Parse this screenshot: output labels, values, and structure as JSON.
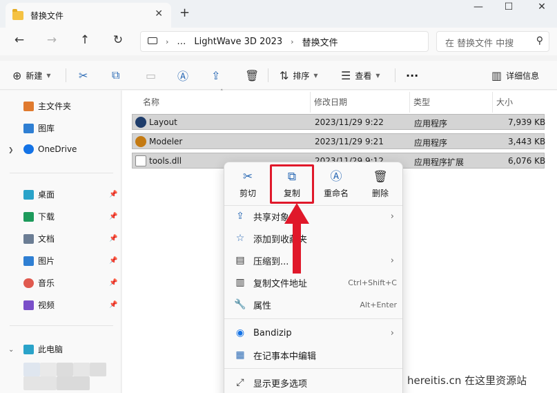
{
  "titlebar": {
    "tab_title": "替换文件",
    "tab_close": "✕",
    "new_tab": "+",
    "minimize": "—",
    "maximize": "☐",
    "close": "✕"
  },
  "addressbar": {
    "back": "←",
    "forward": "→",
    "up": "↑",
    "refresh": "↻",
    "breadcrumbs": [
      "…",
      "LightWave 3D 2023",
      "替换文件"
    ],
    "separator": "›",
    "search_placeholder": "在 替换文件 中搜",
    "search_icon": "search-icon"
  },
  "toolbar": {
    "new_label": "新建",
    "sort_label": "排序",
    "view_label": "查看",
    "more": "···",
    "details_label": "详细信息"
  },
  "sidebar": {
    "items": [
      {
        "label": "主文件夹",
        "icon": "home-icon",
        "color": "#e07a2e"
      },
      {
        "label": "图库",
        "icon": "gallery-icon",
        "color": "#2f7fd3"
      },
      {
        "label": "OneDrive",
        "icon": "cloud-icon",
        "color": "#1473e6"
      },
      {
        "label": "桌面",
        "icon": "desktop-icon",
        "color": "#2aa3c9"
      },
      {
        "label": "下载",
        "icon": "download-icon",
        "color": "#1d9a5b"
      },
      {
        "label": "文档",
        "icon": "document-icon",
        "color": "#6b7d94"
      },
      {
        "label": "图片",
        "icon": "pictures-icon",
        "color": "#2f7fd3"
      },
      {
        "label": "音乐",
        "icon": "music-icon",
        "color": "#e05a4f"
      },
      {
        "label": "视频",
        "icon": "video-icon",
        "color": "#7a4fc9"
      },
      {
        "label": "此电脑",
        "icon": "this-pc-icon",
        "color": "#2aa3c9"
      }
    ],
    "pin_glyph": "📌"
  },
  "filelist": {
    "columns": [
      "名称",
      "修改日期",
      "类型",
      "大小"
    ],
    "rows": [
      {
        "name": "Layout",
        "date": "2023/11/29 9:22",
        "type": "应用程序",
        "size": "7,939 KB",
        "icon": "layout-app-icon",
        "color": "#1f3d6b"
      },
      {
        "name": "Modeler",
        "date": "2023/11/29 9:21",
        "type": "应用程序",
        "size": "3,443 KB",
        "icon": "modeler-app-icon",
        "color": "#c47a12"
      },
      {
        "name": "tools.dll",
        "date": "2023/11/29 9:12",
        "type": "应用程序扩展",
        "size": "6,076 KB",
        "icon": "dll-file-icon",
        "color": "#6b6b6b"
      }
    ]
  },
  "context_menu": {
    "quick_actions": [
      {
        "label": "剪切",
        "icon": "scissors-icon"
      },
      {
        "label": "复制",
        "icon": "copy-icon"
      },
      {
        "label": "重命名",
        "icon": "rename-icon"
      },
      {
        "label": "删除",
        "icon": "trash-icon"
      }
    ],
    "items": [
      {
        "label": "共享对象",
        "icon": "share-icon",
        "shortcut": "",
        "submenu": true
      },
      {
        "label": "添加到收藏夹",
        "icon": "star-icon",
        "shortcut": "",
        "submenu": false
      },
      {
        "label": "压缩到...",
        "icon": "zip-icon",
        "shortcut": "",
        "submenu": true
      },
      {
        "label": "复制文件地址",
        "icon": "copy-path-icon",
        "shortcut": "Ctrl+Shift+C",
        "submenu": false
      },
      {
        "label": "属性",
        "icon": "wrench-icon",
        "shortcut": "Alt+Enter",
        "submenu": false
      },
      {
        "label": "Bandizip",
        "icon": "bandizip-icon",
        "shortcut": "",
        "submenu": true
      },
      {
        "label": "在记事本中编辑",
        "icon": "notepad-icon",
        "shortcut": "",
        "submenu": false
      },
      {
        "label": "显示更多选项",
        "icon": "more-options-icon",
        "shortcut": "",
        "submenu": false
      }
    ],
    "submenu_glyph": "›"
  },
  "annotation": {
    "highlight_color": "#e0182a"
  },
  "watermark": "hereitis.cn 在这里资源站"
}
